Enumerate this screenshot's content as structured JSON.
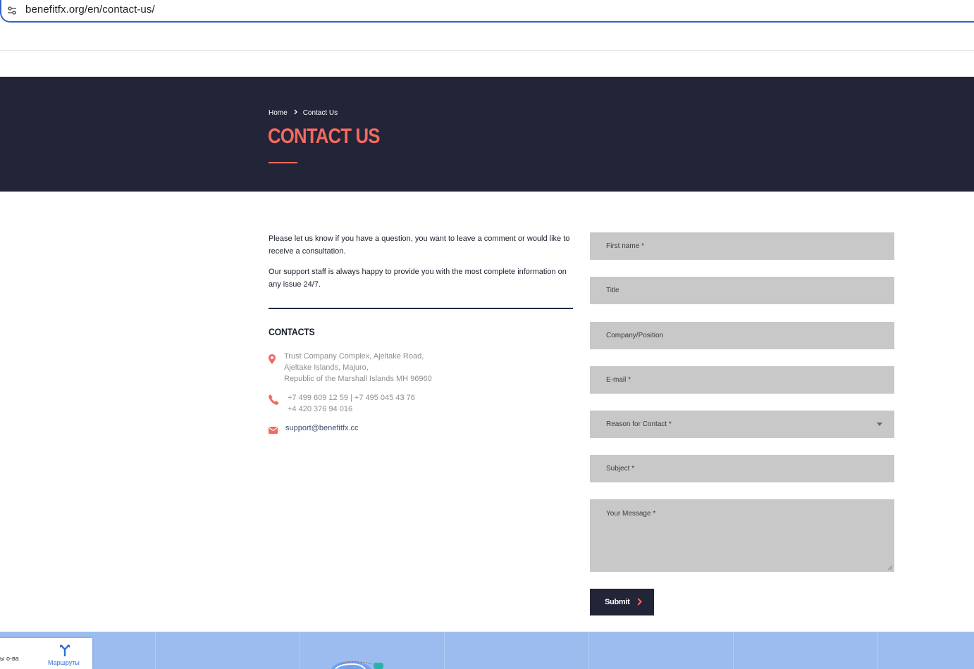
{
  "browser": {
    "url": "benefitfx.org/en/contact-us/",
    "site_info_icon": "tune-icon"
  },
  "hero": {
    "breadcrumb": {
      "home": "Home",
      "current": "Contact Us",
      "separator_icon": "chevron-right-icon"
    },
    "title": "CONTACT US",
    "accent_color": "#f26a5f",
    "background_color": "#222438"
  },
  "intro": {
    "paragraph1": "Please let us know if you have a question, you want to leave a comment or would like to receive a consultation.",
    "paragraph2": "Our support staff is always happy to provide you with the most complete information on any issue 24/7."
  },
  "contacts": {
    "heading": "CONTACTS",
    "address": {
      "icon": "location-pin-icon",
      "lines": [
        "Trust Company Complex, Ajeltake Road,",
        "Ajeltake Islands, Majuro,",
        "Republic of the Marshall Islands MH 96960"
      ]
    },
    "phones": {
      "icon": "phone-icon",
      "lines": [
        "+7 499 609 12 59 | +7 495 045 43 76",
        "+4 420 376 94 016"
      ]
    },
    "email": {
      "icon": "envelope-icon",
      "value": "support@benefitfx.cc"
    }
  },
  "form": {
    "first_name": {
      "placeholder": "First name *"
    },
    "title": {
      "placeholder": "Title"
    },
    "company": {
      "placeholder": "Company/Position"
    },
    "email": {
      "placeholder": "E-mail *"
    },
    "reason": {
      "selected": "Reason for Contact *"
    },
    "subject": {
      "placeholder": "Subject *"
    },
    "message": {
      "placeholder": "Your Message *"
    },
    "submit_label": "Submit",
    "field_color": "#c8c8c8"
  },
  "map": {
    "panel_cut_text": "ы о-ва",
    "routes_label": "Маршруты",
    "routes_icon": "routes-icon",
    "background_color": "#9cbcf0"
  }
}
